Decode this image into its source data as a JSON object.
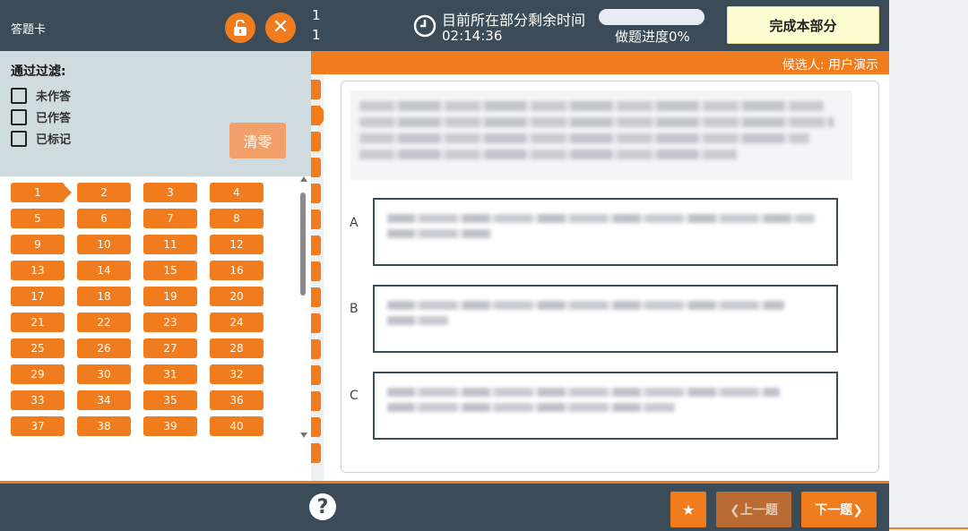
{
  "header": {
    "card_title": "答题卡",
    "counter_top": "1",
    "counter_bottom": "1",
    "timer_label": "目前所在部分剩余时间",
    "timer_value": "02:14:36",
    "progress_label": "做题进度0%",
    "progress_fraction": 0,
    "finish_label": "完成本部分",
    "lock_icon": "unlock-icon",
    "close_icon": "close-icon",
    "clock_icon": "clock-icon"
  },
  "candidate": "候选人: 用户演示",
  "filter": {
    "title": "通过过滤:",
    "options": [
      "未作答",
      "已作答",
      "已标记"
    ],
    "clear_label": "清零"
  },
  "questions": {
    "numbers": [
      "1",
      "2",
      "3",
      "4",
      "5",
      "6",
      "7",
      "8",
      "9",
      "10",
      "11",
      "12",
      "13",
      "14",
      "15",
      "16",
      "17",
      "18",
      "19",
      "20",
      "21",
      "22",
      "23",
      "24",
      "25",
      "26",
      "27",
      "28",
      "29",
      "30",
      "31",
      "32",
      "33",
      "34",
      "35",
      "36",
      "37",
      "38",
      "39",
      "40"
    ],
    "current": "1"
  },
  "options": [
    {
      "letter": "A"
    },
    {
      "letter": "B"
    },
    {
      "letter": "C"
    }
  ],
  "footer": {
    "help_icon": "?",
    "star_icon": "★",
    "prev_label": "❮上一题",
    "next_label": "下一题❯"
  },
  "colors": {
    "accent": "#f07c1e",
    "dark": "#3b4b57",
    "finish_bg": "#fefcd1",
    "filter_bg": "#d0dbe0"
  }
}
